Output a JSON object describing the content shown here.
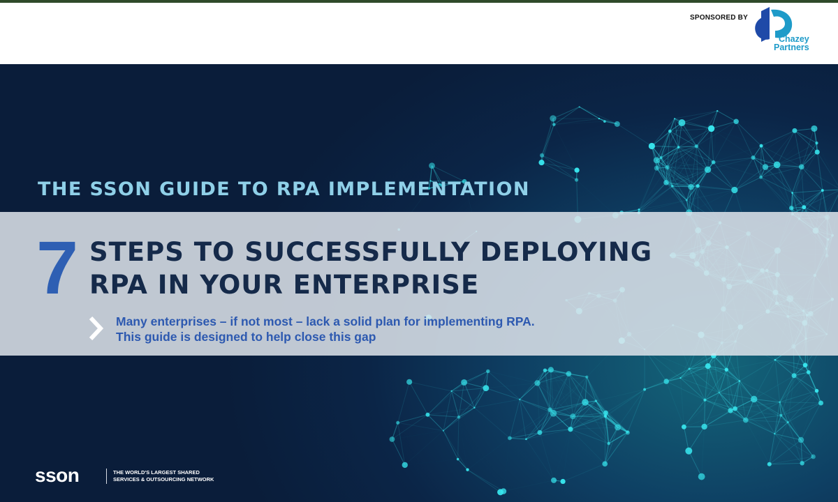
{
  "header": {
    "sponsored_label": "SPONSORED BY",
    "sponsor_name_line1": "Chazey",
    "sponsor_name_line2": "Partners"
  },
  "hero": {
    "guide_title": "THE SSON GUIDE TO RPA IMPLEMENTATION",
    "step_number": "7",
    "headline_line1": "STEPS TO SUCCESSFULLY DEPLOYING",
    "headline_line2": "RPA IN YOUR ENTERPRISE",
    "intro_line1": "Many enterprises – if not most – lack a solid plan for implementing RPA.",
    "intro_line2": "This guide is designed to help close this gap"
  },
  "footer": {
    "sson_wordmark": "sson",
    "sson_tag_line1": "THE WORLD'S LARGEST SHARED",
    "sson_tag_line2": "SERVICES & OUTSOURCING NETWORK"
  },
  "colors": {
    "accent_blue": "#2e5fb3",
    "headline_navy": "#152a4a",
    "guide_title_cyan": "#8fd0e8",
    "sponsor_teal": "#1e9bc9",
    "network_cyan": "#38e6ee"
  }
}
